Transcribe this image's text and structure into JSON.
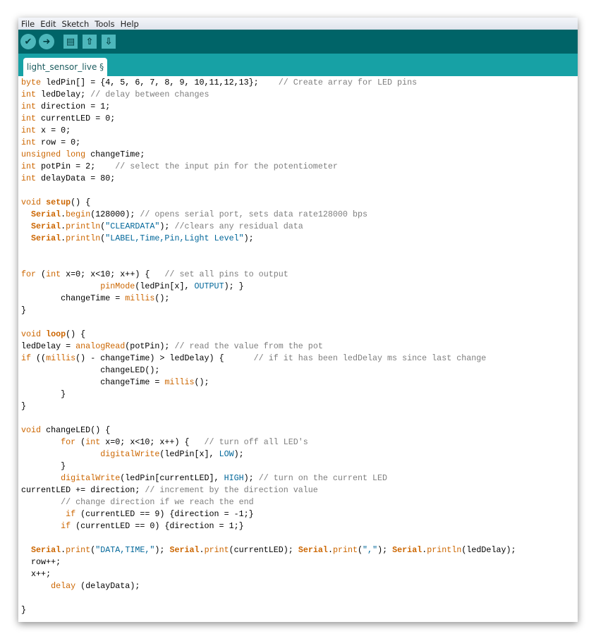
{
  "menu": [
    "File",
    "Edit",
    "Sketch",
    "Tools",
    "Help"
  ],
  "toolbar": {
    "buttons": [
      {
        "name": "verify",
        "icon": "checkmark-icon",
        "glyph": "✔"
      },
      {
        "name": "upload",
        "icon": "arrow-right-icon",
        "glyph": "➜"
      },
      {
        "name": "new",
        "icon": "new-file-icon",
        "glyph": "▤"
      },
      {
        "name": "open",
        "icon": "arrow-up-icon",
        "glyph": "⇧"
      },
      {
        "name": "save",
        "icon": "arrow-down-icon",
        "glyph": "⇩"
      }
    ]
  },
  "tab": {
    "label": "light_sensor_live §"
  },
  "colors": {
    "toolbar": "#006468",
    "tabstrip": "#17a1a5",
    "keyword": "#cc6600",
    "constant": "#006699",
    "comment": "#7e7e7e"
  },
  "code": [
    "byte ledPin[] = {4, 5, 6, 7, 8, 9, 10,11,12,13};    // Create array for LED pins",
    "int ledDelay; // delay between changes",
    "int direction = 1;",
    "int currentLED = 0;",
    "int x = 0;",
    "int row = 0;",
    "unsigned long changeTime;",
    "int potPin = 2;    // select the input pin for the potentiometer",
    "int delayData = 80;",
    "",
    "void setup() {",
    "  Serial.begin(128000); // opens serial port, sets data rate128000 bps",
    "  Serial.println(\"CLEARDATA\"); //clears any residual data",
    "  Serial.println(\"LABEL,Time,Pin,Light Level\");",
    "",
    "",
    "for (int x=0; x<10; x++) {   // set all pins to output",
    "                pinMode(ledPin[x], OUTPUT); }",
    "        changeTime = millis();",
    "}",
    "",
    "void loop() {",
    "ledDelay = analogRead(potPin); // read the value from the pot",
    "if ((millis() - changeTime) > ledDelay) {      // if it has been ledDelay ms since last change",
    "                changeLED();",
    "                changeTime = millis();",
    "        }",
    "}",
    "",
    "void changeLED() {",
    "        for (int x=0; x<10; x++) {   // turn off all LED's",
    "                digitalWrite(ledPin[x], LOW);",
    "        }",
    "        digitalWrite(ledPin[currentLED], HIGH); // turn on the current LED",
    "currentLED += direction; // increment by the direction value",
    "        // change direction if we reach the end",
    "         if (currentLED == 9) {direction = -1;}",
    "        if (currentLED == 0) {direction = 1;}",
    "",
    "  Serial.print(\"DATA,TIME,\"); Serial.print(currentLED); Serial.print(\",\"); Serial.println(ledDelay);",
    "  row++;",
    "  x++;",
    "      delay (delayData);",
    "",
    "}"
  ]
}
